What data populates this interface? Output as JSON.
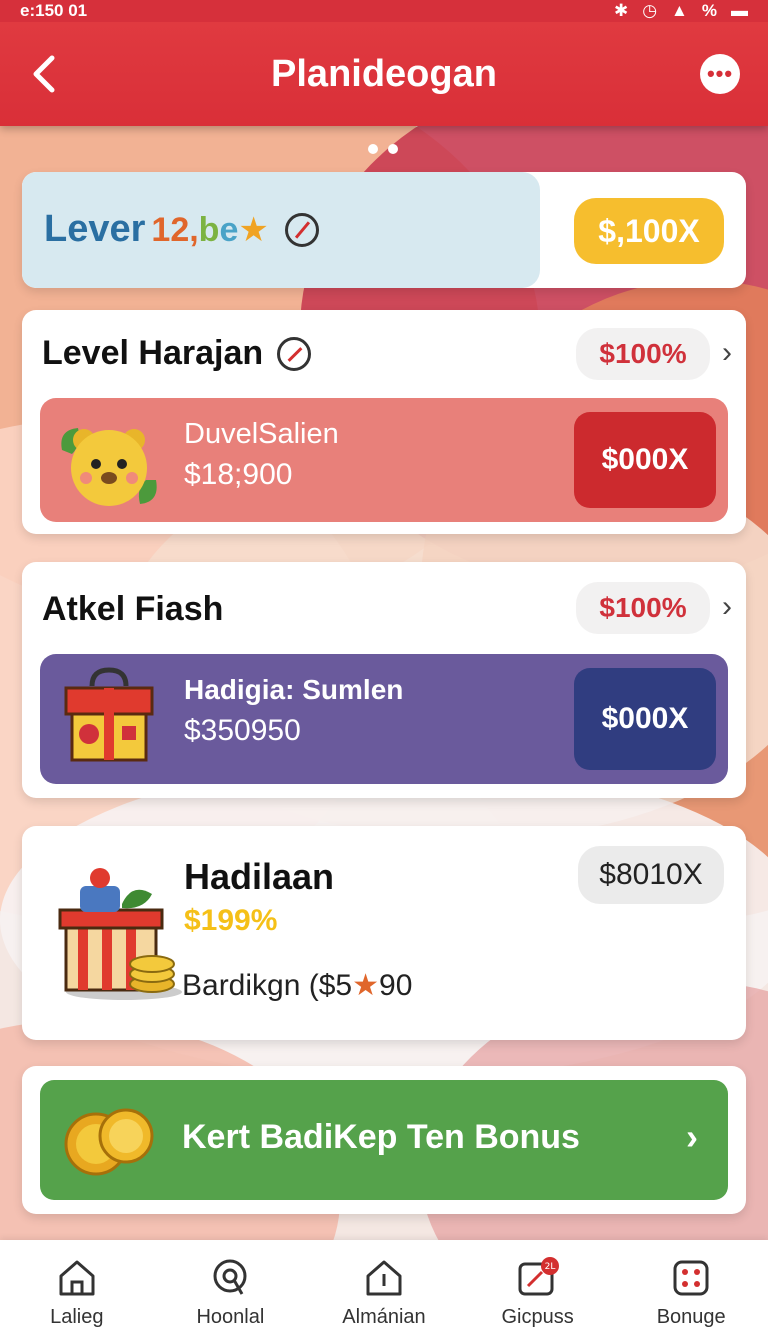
{
  "status_bar": {
    "time": "e:150 01",
    "right_icons": [
      "bluetooth-icon",
      "alarm-icon",
      "signal-icon",
      "battery-icon"
    ],
    "battery": "%"
  },
  "app_bar": {
    "title": "Planideogan"
  },
  "level_card": {
    "label": "Lever",
    "rainbow_text": "12,be",
    "value_pill": "$,100X"
  },
  "section1": {
    "title": "Level Harajan",
    "pill": "$100%",
    "item": {
      "name": "DuvelSalien",
      "price": "$18;900",
      "button": "$000X"
    }
  },
  "section2": {
    "title": "Atkel Fiash",
    "pill": "$100%",
    "item": {
      "name": "Hadigia: Sumlen",
      "price": "$350950",
      "button": "$000X"
    }
  },
  "promo": {
    "title": "Hadilaan",
    "percent": "$199%",
    "subtitle_prefix": "Bardikgn ($5",
    "subtitle_suffix": "90",
    "pill": "$8010X"
  },
  "bonus_banner": {
    "label": "Kert BadiKep Ten Bonus"
  },
  "bottom_nav": [
    {
      "label": "Lalieg",
      "icon": "home-icon"
    },
    {
      "label": "Hoonlal",
      "icon": "search-icon"
    },
    {
      "label": "Almánian",
      "icon": "house-alert-icon"
    },
    {
      "label": "Gicpuss",
      "icon": "notification-icon",
      "badge": "2L"
    },
    {
      "label": "Bonuge",
      "icon": "dice-icon"
    }
  ],
  "colors": {
    "primary": "#d92f38",
    "gold": "#f6be2e",
    "green": "#55a24b",
    "purple": "#6a5a9c",
    "navy": "#303d80"
  }
}
